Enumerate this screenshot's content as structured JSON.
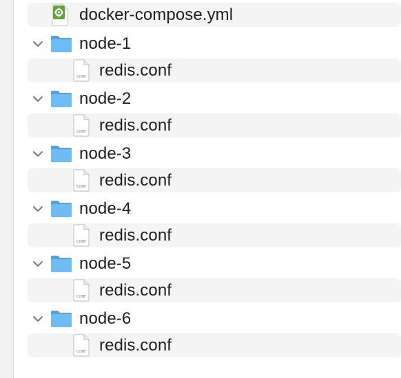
{
  "tree": {
    "root_file": {
      "name": "docker-compose.yml",
      "icon": "yaml-file-icon"
    },
    "folders": [
      {
        "name": "node-1",
        "expanded": true,
        "children": [
          {
            "name": "redis.conf",
            "icon": "conf-file-icon",
            "icon_text": "CONF"
          }
        ]
      },
      {
        "name": "node-2",
        "expanded": true,
        "children": [
          {
            "name": "redis.conf",
            "icon": "conf-file-icon",
            "icon_text": "CONF"
          }
        ]
      },
      {
        "name": "node-3",
        "expanded": true,
        "children": [
          {
            "name": "redis.conf",
            "icon": "conf-file-icon",
            "icon_text": "CONF"
          }
        ]
      },
      {
        "name": "node-4",
        "expanded": true,
        "children": [
          {
            "name": "redis.conf",
            "icon": "conf-file-icon",
            "icon_text": "CONF"
          }
        ]
      },
      {
        "name": "node-5",
        "expanded": true,
        "children": [
          {
            "name": "redis.conf",
            "icon": "conf-file-icon",
            "icon_text": "CONF"
          }
        ]
      },
      {
        "name": "node-6",
        "expanded": true,
        "children": [
          {
            "name": "redis.conf",
            "icon": "conf-file-icon",
            "icon_text": "CONF"
          }
        ]
      }
    ]
  },
  "colors": {
    "folder_blue": "#5fb3f0",
    "folder_tab": "#4aa4e8",
    "alt_row": "#f4f4f4",
    "yml_green": "#5aa832"
  }
}
